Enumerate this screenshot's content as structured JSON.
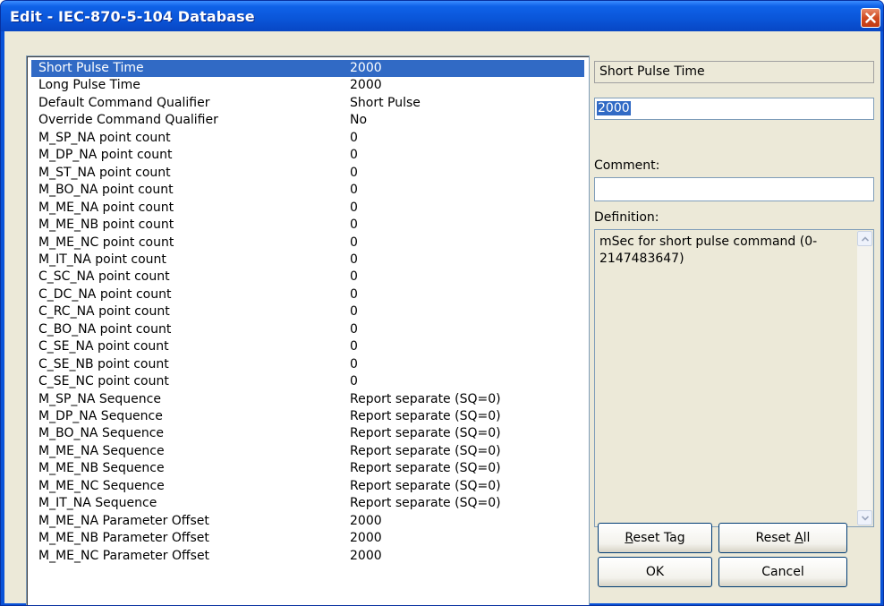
{
  "window": {
    "title": "Edit - IEC-870-5-104 Database"
  },
  "list": {
    "rows": [
      {
        "key": "Short Pulse Time",
        "value": "2000",
        "selected": true
      },
      {
        "key": "Long Pulse Time",
        "value": "2000"
      },
      {
        "key": "Default Command Qualifier",
        "value": "Short Pulse"
      },
      {
        "key": "Override Command Qualifier",
        "value": "No"
      },
      {
        "key": "M_SP_NA point count",
        "value": "0"
      },
      {
        "key": "M_DP_NA point count",
        "value": "0"
      },
      {
        "key": "M_ST_NA point count",
        "value": "0"
      },
      {
        "key": "M_BO_NA point count",
        "value": "0"
      },
      {
        "key": "M_ME_NA point count",
        "value": "0"
      },
      {
        "key": "M_ME_NB point count",
        "value": "0"
      },
      {
        "key": "M_ME_NC point count",
        "value": "0"
      },
      {
        "key": "M_IT_NA point count",
        "value": "0"
      },
      {
        "key": "C_SC_NA point count",
        "value": "0"
      },
      {
        "key": "C_DC_NA point count",
        "value": "0"
      },
      {
        "key": "C_RC_NA point count",
        "value": "0"
      },
      {
        "key": "C_BO_NA point count",
        "value": "0"
      },
      {
        "key": "C_SE_NA point count",
        "value": "0"
      },
      {
        "key": "C_SE_NB point count",
        "value": "0"
      },
      {
        "key": "C_SE_NC point count",
        "value": "0"
      },
      {
        "key": "M_SP_NA Sequence",
        "value": "Report separate (SQ=0)"
      },
      {
        "key": "M_DP_NA Sequence",
        "value": "Report separate (SQ=0)"
      },
      {
        "key": "M_BO_NA Sequence",
        "value": "Report separate (SQ=0)"
      },
      {
        "key": "M_ME_NA Sequence",
        "value": "Report separate (SQ=0)"
      },
      {
        "key": "M_ME_NB Sequence",
        "value": "Report separate (SQ=0)"
      },
      {
        "key": "M_ME_NC Sequence",
        "value": "Report separate (SQ=0)"
      },
      {
        "key": "M_IT_NA Sequence",
        "value": "Report separate (SQ=0)"
      },
      {
        "key": "M_ME_NA Parameter Offset",
        "value": "2000"
      },
      {
        "key": "M_ME_NB Parameter Offset",
        "value": "2000"
      },
      {
        "key": "M_ME_NC Parameter Offset",
        "value": "2000"
      }
    ]
  },
  "panel": {
    "param_name": "Short Pulse Time",
    "value": "2000",
    "comment_label": "Comment:",
    "comment_value": "",
    "definition_label": "Definition:",
    "definition_text": "mSec for short pulse command (0-2147483647)"
  },
  "buttons": {
    "reset_tag": {
      "pre": "",
      "u": "R",
      "post": "eset Tag"
    },
    "reset_all": {
      "pre": "Reset ",
      "u": "A",
      "post": "ll"
    },
    "ok": "OK",
    "cancel": "Cancel"
  },
  "icons": {
    "close": "close-icon",
    "scroll_up": "scroll-up-arrow-icon",
    "scroll_down": "scroll-down-arrow-icon"
  },
  "colors": {
    "titlebar": "#0a55d8",
    "selection": "#316ac5",
    "face": "#ece9d8",
    "close": "#d04a20"
  }
}
